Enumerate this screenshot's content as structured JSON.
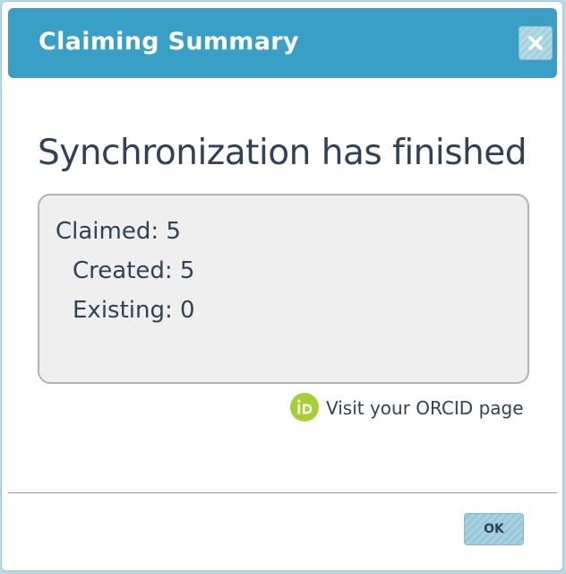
{
  "dialog": {
    "title": "Claiming Summary",
    "close_icon": "close-icon"
  },
  "main": {
    "heading": "Synchronization has finished",
    "summary": {
      "claimed": "Claimed: 5",
      "created": "Created: 5",
      "existing": "Existing: 0"
    },
    "orcid_link": {
      "icon": "orcid-icon",
      "label": "Visit your ORCID page"
    }
  },
  "footer": {
    "ok_label": "OK"
  },
  "colors": {
    "titlebar": "#3a9fc5",
    "text": "#2f4257",
    "orcid_green": "#a6ce39"
  }
}
